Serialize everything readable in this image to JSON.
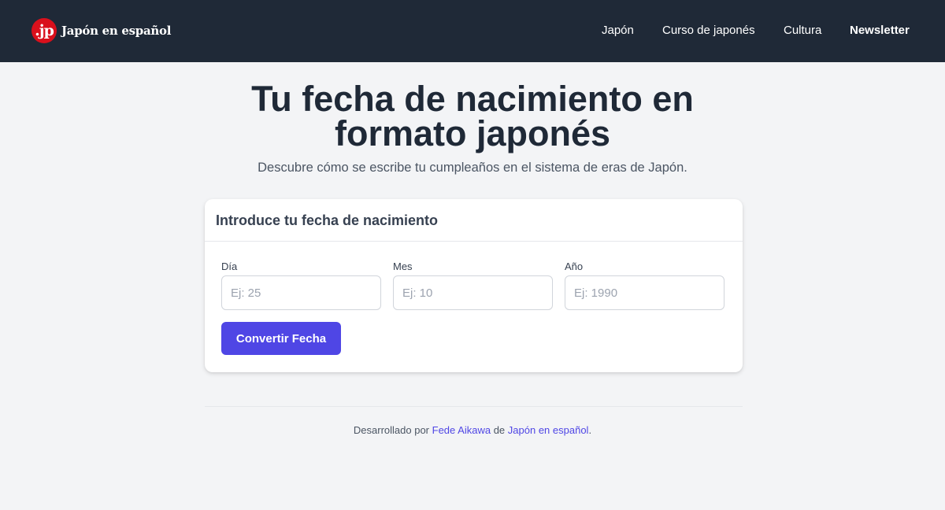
{
  "header": {
    "logo_badge": ".jp",
    "logo_text": "Japón en español",
    "nav": [
      {
        "label": "Japón"
      },
      {
        "label": "Curso de japonés"
      },
      {
        "label": "Cultura"
      },
      {
        "label": "Newsletter"
      }
    ]
  },
  "hero": {
    "title_line1": "Tu fecha de nacimiento en",
    "title_line2": "formato japonés",
    "subtitle": "Descubre cómo se escribe tu cumpleaños en el sistema de eras de Japón."
  },
  "form": {
    "card_title": "Introduce tu fecha de nacimiento",
    "fields": [
      {
        "label": "Día",
        "placeholder": "Ej: 25",
        "value": ""
      },
      {
        "label": "Mes",
        "placeholder": "Ej: 10",
        "value": ""
      },
      {
        "label": "Año",
        "placeholder": "Ej: 1990",
        "value": ""
      }
    ],
    "submit_label": "Convertir Fecha"
  },
  "footer": {
    "prefix": "Desarrollado por",
    "author": "Fede Aikawa",
    "connector": "de",
    "site": "Japón en español",
    "suffix": "."
  },
  "colors": {
    "header_bg": "#1f2937",
    "logo_badge": "#d9101c",
    "accent": "#4f46e5",
    "page_bg": "#f3f4f6"
  }
}
